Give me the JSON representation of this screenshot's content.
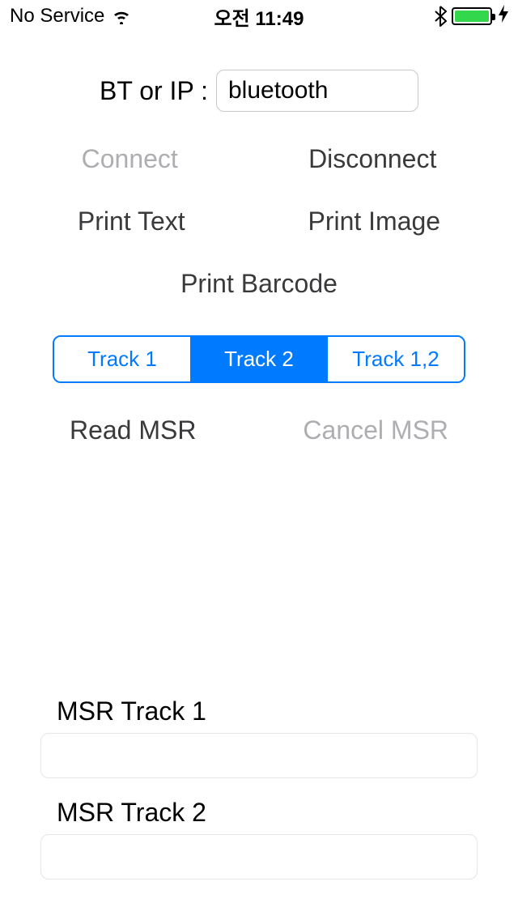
{
  "status": {
    "carrier": "No Service",
    "time": "오전 11:49"
  },
  "input": {
    "label": "BT or IP :",
    "value": "bluetooth"
  },
  "buttons": {
    "connect": "Connect",
    "disconnect": "Disconnect",
    "print_text": "Print Text",
    "print_image": "Print Image",
    "print_barcode": "Print Barcode",
    "read_msr": "Read MSR",
    "cancel_msr": "Cancel MSR"
  },
  "segments": {
    "track1": "Track 1",
    "track2": "Track 2",
    "track12": "Track 1,2"
  },
  "msr": {
    "label1": "MSR Track 1",
    "value1": "",
    "label2": "MSR Track 2",
    "value2": ""
  }
}
